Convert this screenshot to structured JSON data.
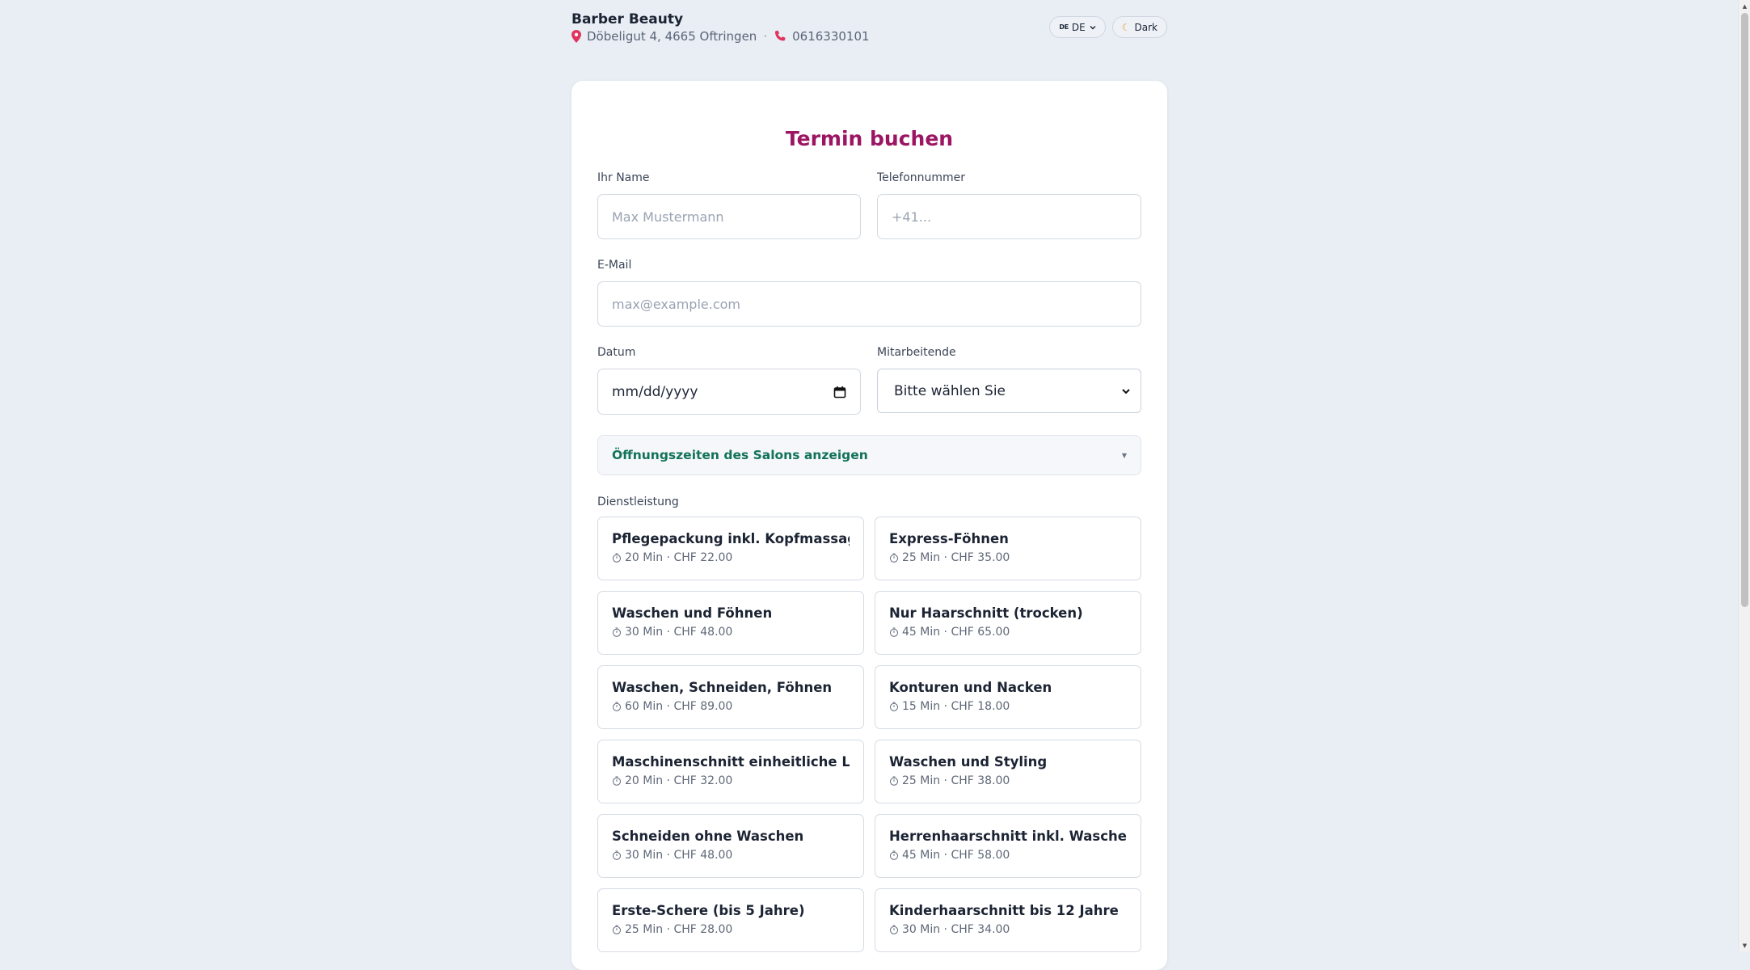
{
  "header": {
    "brand": "Barber Beauty",
    "address": "Döbeligut 4, 4665 Oftringen",
    "separator": "·",
    "phone": "0616330101",
    "language": {
      "flag": "DE",
      "label": "DE"
    },
    "theme_label": "Dark"
  },
  "form": {
    "title": "Termin buchen",
    "name": {
      "label": "Ihr Name",
      "placeholder": "Max Mustermann"
    },
    "phone": {
      "label": "Telefonnummer",
      "placeholder": "+41..."
    },
    "email": {
      "label": "E-Mail",
      "placeholder": "max@example.com"
    },
    "date": {
      "label": "Datum",
      "value": "mm/dd/yyyy"
    },
    "staff": {
      "label": "Mitarbeitende",
      "value": "Bitte wählen Sie"
    },
    "hours_toggle": "Öffnungszeiten des Salons anzeigen",
    "services_label": "Dienstleistung",
    "services": [
      {
        "name": "Pflegepackung inkl. Kopfmassage",
        "meta": "20 Min · CHF 22.00"
      },
      {
        "name": "Express-Föhnen",
        "meta": "25 Min · CHF 35.00"
      },
      {
        "name": "Waschen und Föhnen",
        "meta": "30 Min · CHF 48.00"
      },
      {
        "name": "Nur Haarschnitt (trocken)",
        "meta": "45 Min · CHF 65.00"
      },
      {
        "name": "Waschen, Schneiden, Föhnen",
        "meta": "60 Min · CHF 89.00"
      },
      {
        "name": "Konturen und Nacken",
        "meta": "15 Min · CHF 18.00"
      },
      {
        "name": "Maschinenschnitt einheitliche Laenge",
        "meta": "20 Min · CHF 32.00"
      },
      {
        "name": "Waschen und Styling",
        "meta": "25 Min · CHF 38.00"
      },
      {
        "name": "Schneiden ohne Waschen",
        "meta": "30 Min · CHF 48.00"
      },
      {
        "name": "Herrenhaarschnitt inkl. Waschen",
        "meta": "45 Min · CHF 58.00"
      },
      {
        "name": "Erste-Schere (bis 5 Jahre)",
        "meta": "25 Min · CHF 28.00"
      },
      {
        "name": "Kinderhaarschnitt bis 12 Jahre",
        "meta": "30 Min · CHF 34.00"
      }
    ]
  },
  "colors": {
    "accent": "#9b1563",
    "hours_text": "#12725a",
    "background": "#e9eef5",
    "pin": "#e0345e"
  }
}
